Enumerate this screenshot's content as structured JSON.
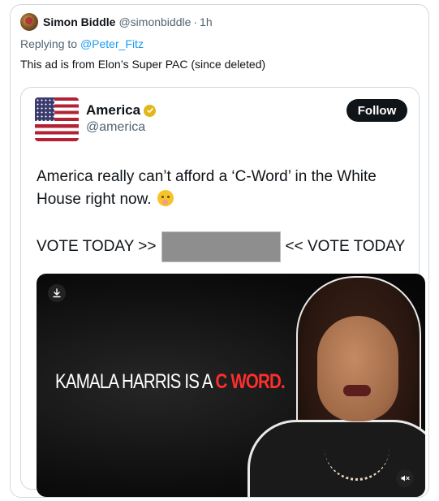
{
  "reply": {
    "author_name": "Simon Biddle",
    "author_handle": "@simonbiddle",
    "separator": "·",
    "time": "1h",
    "replying_prefix": "Replying to ",
    "replying_to": "@Peter_Fitz",
    "text": "This ad is from Elon’s Super PAC (since deleted)"
  },
  "quote": {
    "name": "America",
    "handle": "@america",
    "follow_label": "Follow",
    "body": "America really can’t afford a ‘C-Word’ in the White House right now.",
    "vote_left": "VOTE TODAY >>",
    "vote_right": "<< VOTE TODAY",
    "media": {
      "headline_white": "KAMALA HARRIS IS A ",
      "headline_red": "C WORD."
    }
  },
  "icons": {
    "verified": "gold-verified-badge-icon",
    "download": "download-icon",
    "mute": "speaker-muted-icon"
  },
  "colors": {
    "link": "#1d9bf0",
    "secondary_text": "#536471",
    "follow_bg": "#0f1419",
    "verified": "#e2b719",
    "headline_red": "#ff2e2e"
  }
}
